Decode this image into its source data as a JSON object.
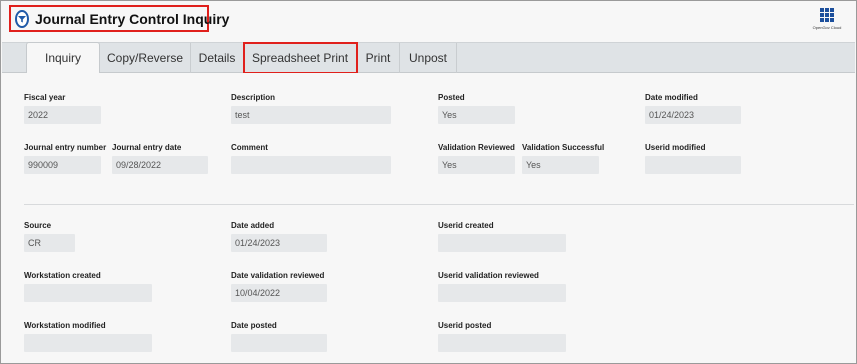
{
  "header": {
    "title": "Journal Entry Control Inquiry",
    "title_icon": "filter-circle-icon",
    "apps_label": "OpenGov Cloud",
    "accent": "#1c4f9c",
    "highlight": "#e0201c"
  },
  "tabs": [
    {
      "label": "Inquiry",
      "active": true
    },
    {
      "label": "Copy/Reverse"
    },
    {
      "label": "Details"
    },
    {
      "label": "Spreadsheet Print",
      "highlighted": true
    },
    {
      "label": "Print"
    },
    {
      "label": "Unpost"
    }
  ],
  "fields": {
    "fiscal_year": {
      "label": "Fiscal year",
      "value": "2022"
    },
    "description": {
      "label": "Description",
      "value": "test"
    },
    "posted": {
      "label": "Posted",
      "value": "Yes"
    },
    "date_modified": {
      "label": "Date modified",
      "value": "01/24/2023"
    },
    "journal_entry_number": {
      "label": "Journal entry number",
      "value": "990009"
    },
    "journal_entry_date": {
      "label": "Journal entry date",
      "value": "09/28/2022"
    },
    "comment": {
      "label": "Comment",
      "value": ""
    },
    "validation_reviewed": {
      "label": "Validation Reviewed",
      "value": "Yes"
    },
    "validation_successful": {
      "label": "Validation Successful",
      "value": "Yes"
    },
    "userid_modified": {
      "label": "Userid modified",
      "value": ""
    },
    "source": {
      "label": "Source",
      "value": "CR"
    },
    "date_added": {
      "label": "Date added",
      "value": "01/24/2023"
    },
    "userid_created": {
      "label": "Userid created",
      "value": ""
    },
    "workstation_created": {
      "label": "Workstation created",
      "value": ""
    },
    "date_validation_reviewed": {
      "label": "Date validation reviewed",
      "value": "10/04/2022"
    },
    "userid_validation_reviewed": {
      "label": "Userid validation reviewed",
      "value": ""
    },
    "workstation_modified": {
      "label": "Workstation modified",
      "value": ""
    },
    "date_posted": {
      "label": "Date posted",
      "value": ""
    },
    "userid_posted": {
      "label": "Userid posted",
      "value": ""
    }
  }
}
